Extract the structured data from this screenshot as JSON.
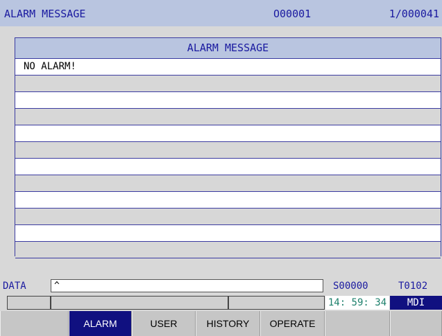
{
  "title_bar": {
    "title": "ALARM MESSAGE",
    "program_number": "O00001",
    "page_indicator": "1/000041"
  },
  "alarm_panel": {
    "header": "ALARM MESSAGE",
    "rows": [
      "NO ALARM!",
      "",
      "",
      "",
      "",
      "",
      "",
      "",
      "",
      "",
      "",
      "",
      ""
    ]
  },
  "data_row": {
    "label": "DATA",
    "input_value": "^",
    "spindle": "S00000",
    "tool": "T0102"
  },
  "status_row": {
    "time": "14: 59: 34",
    "mode": "MDI"
  },
  "softkeys": [
    {
      "label": ""
    },
    {
      "label": "ALARM"
    },
    {
      "label": "USER"
    },
    {
      "label": "HISTORY"
    },
    {
      "label": "OPERATE"
    },
    {
      "label": ""
    },
    {
      "label": ""
    }
  ],
  "colors": {
    "title_bg": "#b9c5e0",
    "title_text": "#1a1aa0",
    "active_key_bg": "#101080",
    "time_text": "#1b7f6a"
  }
}
